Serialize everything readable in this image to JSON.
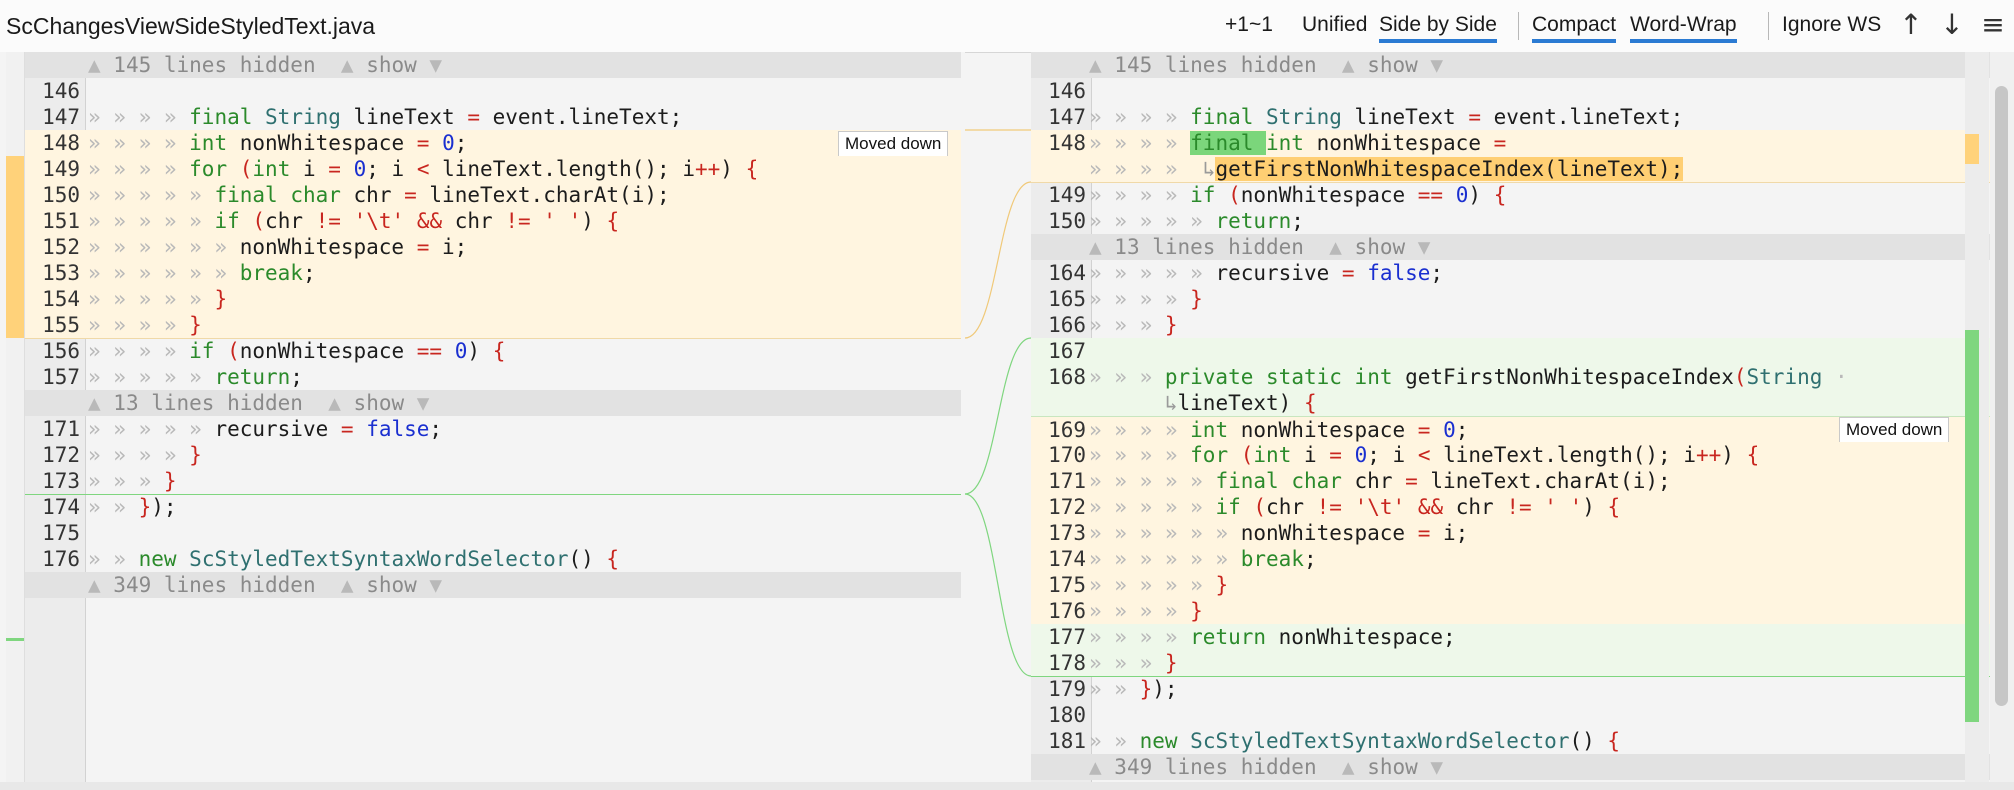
{
  "toolbar": {
    "file_name": "ScChangesViewSideStyledText.java",
    "change_count": "+1~1",
    "unified": "Unified",
    "side_by_side": "Side by Side",
    "compact": "Compact",
    "word_wrap": "Word-Wrap",
    "ignore_ws": "Ignore WS",
    "prev_icon": "arrow-up-icon",
    "next_icon": "arrow-down-icon",
    "menu_icon": "hamburger-menu-icon"
  },
  "left": {
    "fold1": "145 lines hidden",
    "fold2": "13 lines hidden",
    "fold3": "349 lines hidden",
    "show": "show",
    "moved_tag": "Moved down",
    "lines": [
      {
        "n": "146",
        "t": ""
      },
      {
        "n": "147",
        "t": "final String lineText = event.lineText;"
      },
      {
        "n": "148",
        "t": "int nonWhitespace = 0;"
      },
      {
        "n": "149",
        "t": "for (int i = 0; i < lineText.length(); i++) {"
      },
      {
        "n": "150",
        "t": "final char chr = lineText.charAt(i);"
      },
      {
        "n": "151",
        "t": "if (chr != '\\t' && chr != ' ') {"
      },
      {
        "n": "152",
        "t": "nonWhitespace = i;"
      },
      {
        "n": "153",
        "t": "break;"
      },
      {
        "n": "154",
        "t": "}"
      },
      {
        "n": "155",
        "t": "}"
      },
      {
        "n": "156",
        "t": "if (nonWhitespace == 0) {"
      },
      {
        "n": "157",
        "t": "return;"
      },
      {
        "n": "171",
        "t": "recursive = false;"
      },
      {
        "n": "172",
        "t": "}"
      },
      {
        "n": "173",
        "t": "}"
      },
      {
        "n": "174",
        "t": "});"
      },
      {
        "n": "175",
        "t": ""
      },
      {
        "n": "176",
        "t": "new ScStyledTextSyntaxWordSelector() {"
      }
    ]
  },
  "right": {
    "fold1": "145 lines hidden",
    "fold2": "13 lines hidden",
    "fold3": "349 lines hidden",
    "show": "show",
    "moved_tag": "Moved down",
    "lines": [
      {
        "n": "146",
        "t": ""
      },
      {
        "n": "147",
        "t": "final String lineText = event.lineText;"
      },
      {
        "n": "148",
        "t": "final int nonWhitespace ="
      },
      {
        "n": "",
        "t": "getFirstNonWhitespaceIndex(lineText);"
      },
      {
        "n": "149",
        "t": "if (nonWhitespace == 0) {"
      },
      {
        "n": "150",
        "t": "return;"
      },
      {
        "n": "164",
        "t": "recursive = false;"
      },
      {
        "n": "165",
        "t": "}"
      },
      {
        "n": "166",
        "t": "}"
      },
      {
        "n": "167",
        "t": ""
      },
      {
        "n": "168",
        "t": "private static int getFirstNonWhitespaceIndex(String"
      },
      {
        "n": "",
        "t": "lineText) {"
      },
      {
        "n": "169",
        "t": "int nonWhitespace = 0;"
      },
      {
        "n": "170",
        "t": "for (int i = 0; i < lineText.length(); i++) {"
      },
      {
        "n": "171",
        "t": "final char chr = lineText.charAt(i);"
      },
      {
        "n": "172",
        "t": "if (chr != '\\t' && chr != ' ') {"
      },
      {
        "n": "173",
        "t": "nonWhitespace = i;"
      },
      {
        "n": "174",
        "t": "break;"
      },
      {
        "n": "175",
        "t": "}"
      },
      {
        "n": "176",
        "t": "}"
      },
      {
        "n": "177",
        "t": "return nonWhitespace;"
      },
      {
        "n": "178",
        "t": "}"
      },
      {
        "n": "179",
        "t": "});"
      },
      {
        "n": "180",
        "t": ""
      },
      {
        "n": "181",
        "t": "new ScStyledTextSyntaxWordSelector() {"
      }
    ]
  },
  "colors": {
    "moved_bg": "#fff5e0",
    "added_bg": "#eef8ea",
    "moved_marker": "#ffd27a",
    "added_marker": "#7fd67f",
    "accent": "#2b7bd3"
  }
}
